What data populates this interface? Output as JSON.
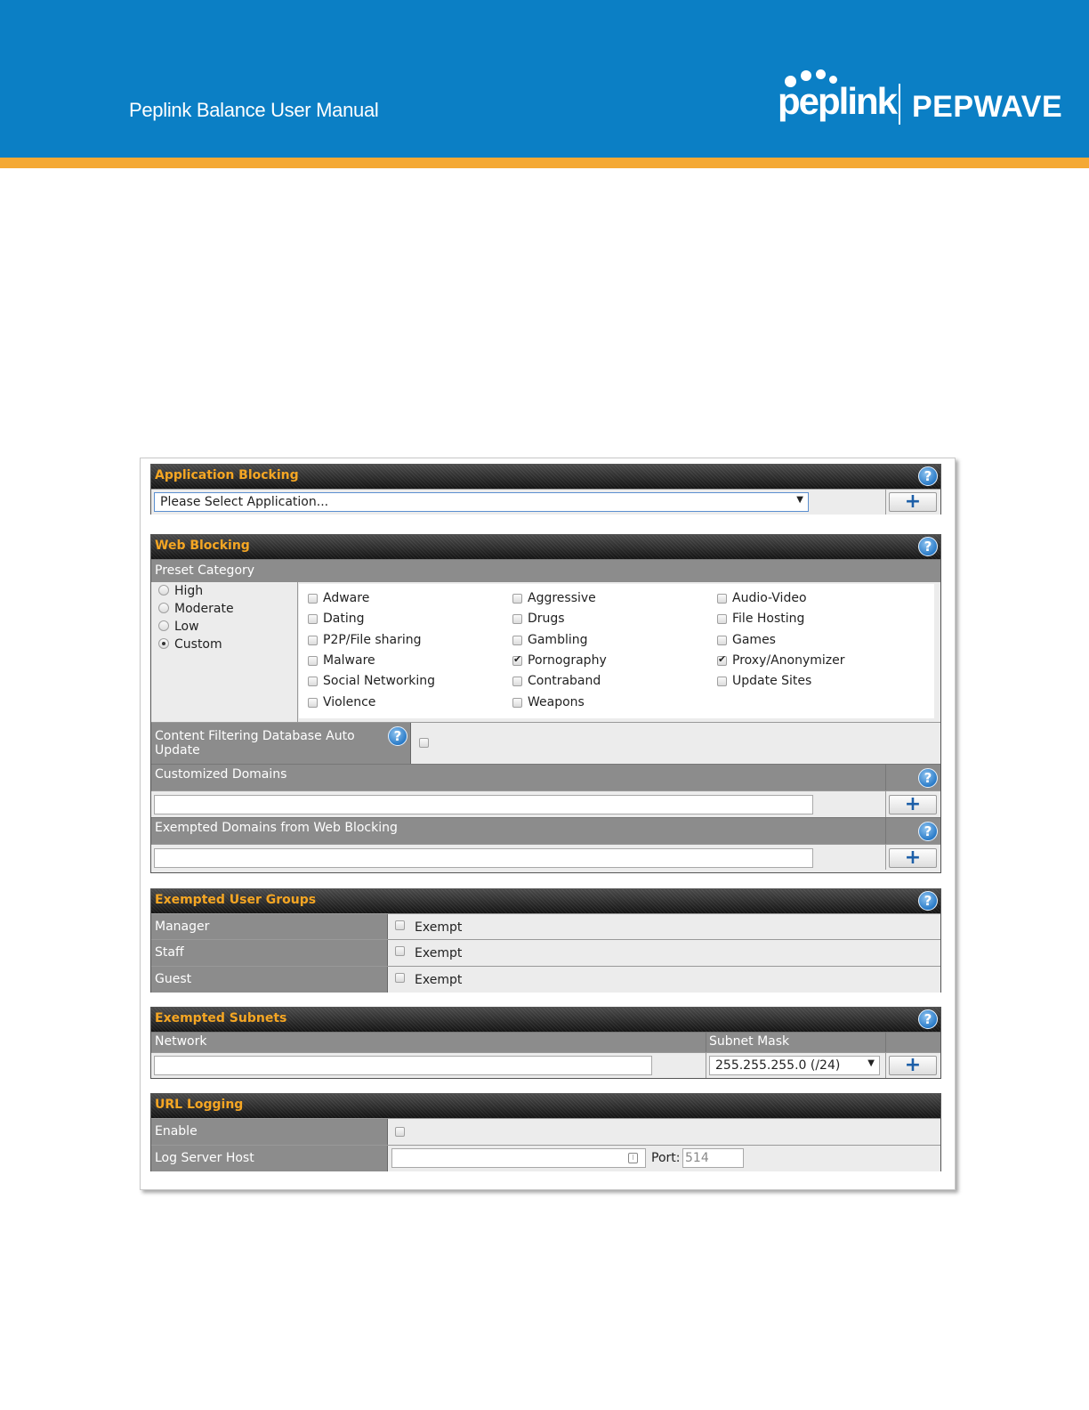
{
  "header": {
    "title": "Peplink Balance User Manual",
    "brand_left": "peplink",
    "brand_right": "PEPWAVE",
    "colors": {
      "band": "#0b7fc5",
      "stripe": "#f4a934"
    }
  },
  "app_blocking": {
    "title": "Application Blocking",
    "select_value": "Please Select Application..."
  },
  "web_blocking": {
    "title": "Web Blocking",
    "preset_header": "Preset Category",
    "presets": [
      "High",
      "Moderate",
      "Low",
      "Custom"
    ],
    "selected_preset": "Custom",
    "categories": [
      {
        "label": "Adware",
        "checked": false
      },
      {
        "label": "Aggressive",
        "checked": false
      },
      {
        "label": "Audio-Video",
        "checked": false
      },
      {
        "label": "Dating",
        "checked": false
      },
      {
        "label": "Drugs",
        "checked": false
      },
      {
        "label": "File Hosting",
        "checked": false
      },
      {
        "label": "P2P/File sharing",
        "checked": false
      },
      {
        "label": "Gambling",
        "checked": false
      },
      {
        "label": "Games",
        "checked": false
      },
      {
        "label": "Malware",
        "checked": false
      },
      {
        "label": "Pornography",
        "checked": true
      },
      {
        "label": "Proxy/Anonymizer",
        "checked": true
      },
      {
        "label": "Social Networking",
        "checked": false
      },
      {
        "label": "Contraband",
        "checked": false
      },
      {
        "label": "Update Sites",
        "checked": false
      },
      {
        "label": "Violence",
        "checked": false
      },
      {
        "label": "Weapons",
        "checked": false
      }
    ],
    "auto_update_label_1": "Content Filtering Database Auto",
    "auto_update_label_2": "Update",
    "customized_domains": "Customized Domains",
    "exempted_domains": "Exempted Domains from Web Blocking"
  },
  "exempted_user_groups": {
    "title": "Exempted User Groups",
    "rows": [
      {
        "label": "Manager",
        "option": "Exempt"
      },
      {
        "label": "Staff",
        "option": "Exempt"
      },
      {
        "label": "Guest",
        "option": "Exempt"
      }
    ]
  },
  "exempted_subnets": {
    "title": "Exempted Subnets",
    "col_network": "Network",
    "col_mask": "Subnet Mask",
    "mask_value": "255.255.255.0 (/24)"
  },
  "url_logging": {
    "title": "URL Logging",
    "enable_label": "Enable",
    "host_label": "Log Server Host",
    "port_label": "Port:",
    "port_value": "514"
  },
  "ui": {
    "help_glyph": "?",
    "add_glyph": "+",
    "help_icon": "help-circle-icon",
    "add_icon": "plus-icon"
  }
}
